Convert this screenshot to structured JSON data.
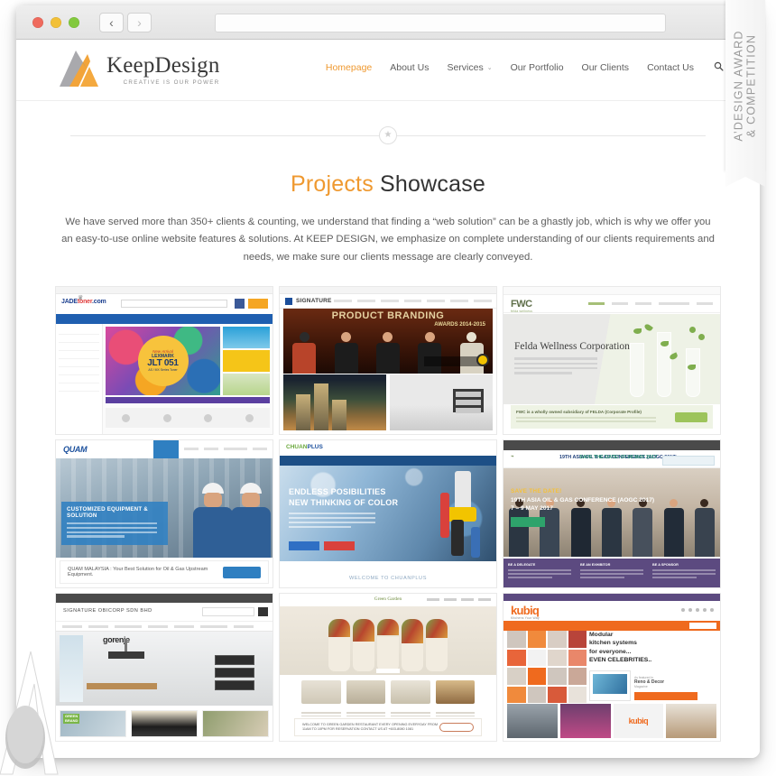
{
  "browser": {
    "back_label": "‹",
    "forward_label": "›",
    "url_value": "",
    "url_placeholder": ""
  },
  "site": {
    "logo": {
      "brand_keep": "Keep",
      "brand_design": "Design",
      "tagline": "CREATIVE IS OUR POWER"
    },
    "nav": [
      {
        "label": "Homepage",
        "active": true
      },
      {
        "label": "About Us",
        "active": false
      },
      {
        "label": "Services",
        "active": false,
        "caret": "⌄"
      },
      {
        "label": "Our Portfolio",
        "active": false
      },
      {
        "label": "Our Clients",
        "active": false
      },
      {
        "label": "Contact Us",
        "active": false
      }
    ],
    "search_icon": "⚲",
    "divider_star": "★",
    "heading": {
      "accent": "Projects",
      "rest": " Showcase"
    },
    "intro": "We have served more than 350+ clients  & counting, we understand that finding a “web solution” can be a ghastly job, which is why we offer you an easy-to-use online website features & solutions. At KEEP DESIGN, we emphasize on complete understanding of our clients requirements and needs, we make sure our clients message are clearly conveyed.",
    "accent_color": "#ef9930"
  },
  "portfolio": [
    {
      "name": "jadetoner",
      "brand_a": "JADE",
      "brand_b": "toner",
      "brand_c": ".com",
      "badge_t1": "New Arrival",
      "badge_t2": "LEXMARK",
      "badge_t3": "JLT 051",
      "badge_t4": "AS / MX Series Toner"
    },
    {
      "name": "signature",
      "brand": "SIGNATURE",
      "hero_title": "PRODUCT BRANDING",
      "hero_sub": "AWARDS 2014-2015"
    },
    {
      "name": "fwc",
      "brand": "FWC",
      "brand_sub": "felda wellness",
      "hero_title": "Felda Wellness Corporation",
      "foot_title": "FWC is a wholly owned subsidiary of FELDA (Corporate Profile)"
    },
    {
      "name": "quam",
      "brand": "QUAM",
      "box_title": "CUSTOMIZED EQUIPMENT & SOLUTION",
      "foot_text": "QUAM MALAYSIA : Your Best Solution for Oil & Gas Upstream Equipment."
    },
    {
      "name": "chuanplus",
      "brand_a": "CHUAN",
      "brand_b": "PLUS",
      "hero_line1": "ENDLESS POSIBILITIES",
      "hero_line2": "NEW THINKING OF COLOR",
      "welcome": "WELCOME TO CHUANPLUS"
    },
    {
      "name": "aogc",
      "head_left": "19TH ASIA OIL & GAS CONFERENCE (AOGC 2017)",
      "head_right": "SAVE THE DATE! 07-09 MAY 2017",
      "overlay_1": "SAVE THE DATE!",
      "overlay_2": "19TH ASIA OIL & GAS CONFERENCE (AOGC 2017)",
      "overlay_3": "7 – 9 MAY 2017",
      "foot": [
        {
          "title": "BE A DELEGATE",
          "lines": 3
        },
        {
          "title": "BE AN EXHIBITOR",
          "lines": 3
        },
        {
          "title": "BE A SPONSOR",
          "lines": 3
        }
      ]
    },
    {
      "name": "obicorp",
      "title": "SIGNATURE OBICORP SDN BHD",
      "hero_brand": "gorenje",
      "tile_badge_1": "GREEN",
      "tile_badge_2": "BRAND"
    },
    {
      "name": "greengarden",
      "brand": "Green Garden",
      "foot_text": "WELCOME TO GREEN GARDEN RESTAURANT EVERY OPENING EVERYDAY FROM 11AM TO 10PM FOR RESERVATION CONTACT US AT +603-8080 1081"
    },
    {
      "name": "kubiq",
      "brand": "kubiq",
      "brand_sub": "Kitchens Your Way",
      "hero_line1": "Modular",
      "hero_line2": "kitchen systems",
      "hero_line3": "for everyone...",
      "hero_line4": "EVEN CELEBRITIES..",
      "mag_label": "As featured in",
      "mag_title": "Reno & Decor",
      "mag_sub": "Magazine",
      "cta": "Click here for more information",
      "footer_brand": "kubiq"
    }
  ],
  "award_ribbon": {
    "line1": "A’DESIGN AWARD",
    "line2": "& COMPETITION"
  }
}
